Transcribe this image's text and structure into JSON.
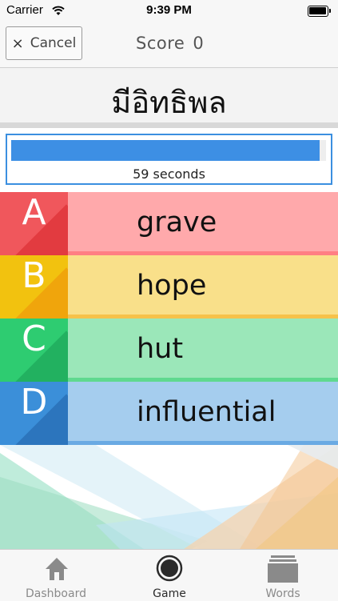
{
  "status_bar": {
    "carrier": "Carrier",
    "time": "9:39 PM"
  },
  "nav": {
    "cancel_icon": "×",
    "cancel_label": "Cancel",
    "score_label": "Score",
    "score_value": "0"
  },
  "question": {
    "word": "มีอิทธิพล"
  },
  "timer": {
    "label": "59 seconds",
    "progress": 0.98
  },
  "answers": [
    {
      "letter": "A",
      "text": "grave",
      "letter_color": "#f0575c",
      "shade_color": "#e23b40",
      "row_color": "#ffa9ab",
      "stripe_color": "#ff7f83"
    },
    {
      "letter": "B",
      "text": "hope",
      "letter_color": "#f2c20f",
      "shade_color": "#f0a50c",
      "row_color": "#f9e08a",
      "stripe_color": "#f6c24a"
    },
    {
      "letter": "C",
      "text": "hut",
      "letter_color": "#2ecc71",
      "shade_color": "#22b160",
      "row_color": "#9be7b9",
      "stripe_color": "#5fd98f"
    },
    {
      "letter": "D",
      "text": "influential",
      "letter_color": "#3b8fd9",
      "shade_color": "#2c75bd",
      "row_color": "#a5cdee",
      "stripe_color": "#6aaae3"
    }
  ],
  "tabs": [
    {
      "label": "Dashboard",
      "icon": "home-icon",
      "active": false
    },
    {
      "label": "Game",
      "icon": "circle-icon",
      "active": true
    },
    {
      "label": "Words",
      "icon": "stack-icon",
      "active": false
    }
  ]
}
